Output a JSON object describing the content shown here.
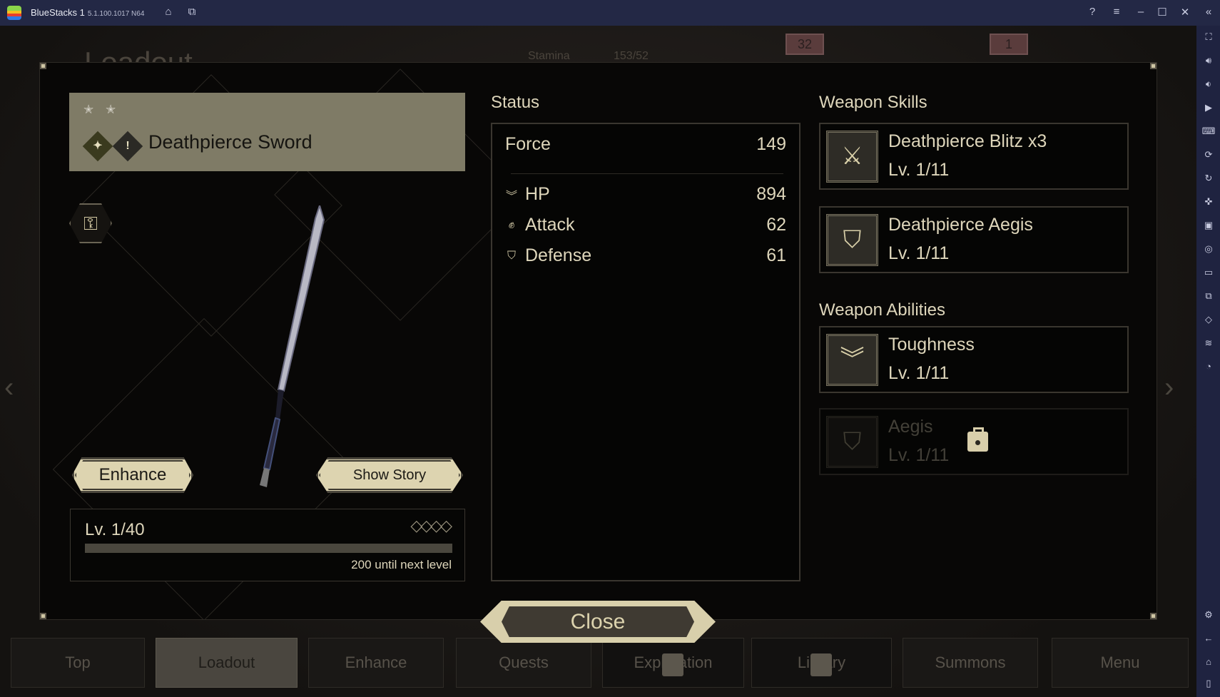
{
  "window": {
    "app_name": "BlueStacks 1",
    "version": "5.1.100.1017 N64",
    "icons": [
      "home-icon",
      "multi-instance-icon",
      "help-icon",
      "menu-icon",
      "minimize-icon",
      "maximize-icon",
      "close-icon",
      "collapse-icon"
    ]
  },
  "sidebar_icons": [
    "fullscreen-icon",
    "volume-up-icon",
    "volume-down-icon",
    "screen-record-icon",
    "keyboard-icon",
    "macro-icon",
    "sync-icon",
    "gamepad-icon",
    "apk-icon",
    "screenshot-icon",
    "folder-icon",
    "multi-instance-icon",
    "eco-mode-icon",
    "layers-icon",
    "performance-icon",
    "settings-icon",
    "back-icon",
    "home-icon",
    "recents-icon"
  ],
  "background": {
    "page_title": "Loadout",
    "stamina_label": "Stamina",
    "stamina_value": "153/52",
    "gift_badge": "32",
    "friends_badge": "1"
  },
  "weapon": {
    "name": "Deathpierce Sword",
    "stars": "✭ ✭",
    "enhance_label": "Enhance",
    "show_story_label": "Show Story",
    "level": "Lv. 1/40",
    "level_progress": 0,
    "next_level": "200 until next level"
  },
  "status": {
    "title": "Status",
    "force_label": "Force",
    "force": "149",
    "stats": [
      {
        "label": "HP",
        "value": "894",
        "icon": "hp-chevron-icon"
      },
      {
        "label": "Attack",
        "value": "62",
        "icon": "fist-icon"
      },
      {
        "label": "Defense",
        "value": "61",
        "icon": "shield-icon"
      }
    ]
  },
  "skills": {
    "title": "Weapon Skills",
    "items": [
      {
        "name": "Deathpierce Blitz x3",
        "level": "Lv. 1/11"
      },
      {
        "name": "Deathpierce Aegis",
        "level": "Lv. 1/11"
      }
    ]
  },
  "abilities": {
    "title": "Weapon Abilities",
    "items": [
      {
        "name": "Toughness",
        "level": "Lv. 1/11",
        "locked": false
      },
      {
        "name": "Aegis",
        "level": "Lv. 1/11",
        "locked": true
      }
    ]
  },
  "close_label": "Close",
  "nav": [
    "Top",
    "Loadout",
    "Enhance",
    "Quests",
    "Exploration",
    "Library",
    "Summons",
    "Menu"
  ],
  "colors": {
    "accent": "#ded6bb",
    "name_box": "#7f7b66",
    "titlebar": "#232845"
  }
}
